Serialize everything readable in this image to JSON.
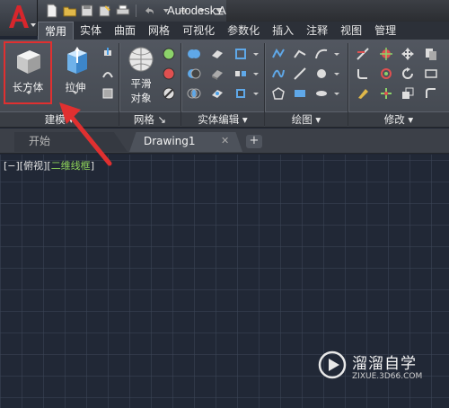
{
  "window": {
    "title": "Autodesk A"
  },
  "ribbon_tabs": [
    "常用",
    "实体",
    "曲面",
    "网格",
    "可视化",
    "参数化",
    "插入",
    "注释",
    "视图",
    "管理"
  ],
  "panels": {
    "modeling": {
      "title": "建模",
      "box_label": "长方体",
      "extrude_label": "拉伸"
    },
    "mesh": {
      "title": "网格",
      "smooth_line1": "平滑",
      "smooth_line2": "对象"
    },
    "solid_edit": {
      "title": "实体编辑"
    },
    "draw": {
      "title": "绘图"
    },
    "modify": {
      "title": "修改"
    }
  },
  "doc_tabs": {
    "start": "开始",
    "drawing": "Drawing1",
    "close": "✕",
    "add": "+"
  },
  "viewport": {
    "prefix": "[−][俯视][",
    "style": "二维线框",
    "suffix": "]"
  },
  "watermark": {
    "name": "溜溜自学",
    "url": "ZIXUE.3D66.COM"
  },
  "colors": {
    "accent_red": "#e03030",
    "canvas_bg": "#212836",
    "viewport_style": "#8fd35a"
  }
}
